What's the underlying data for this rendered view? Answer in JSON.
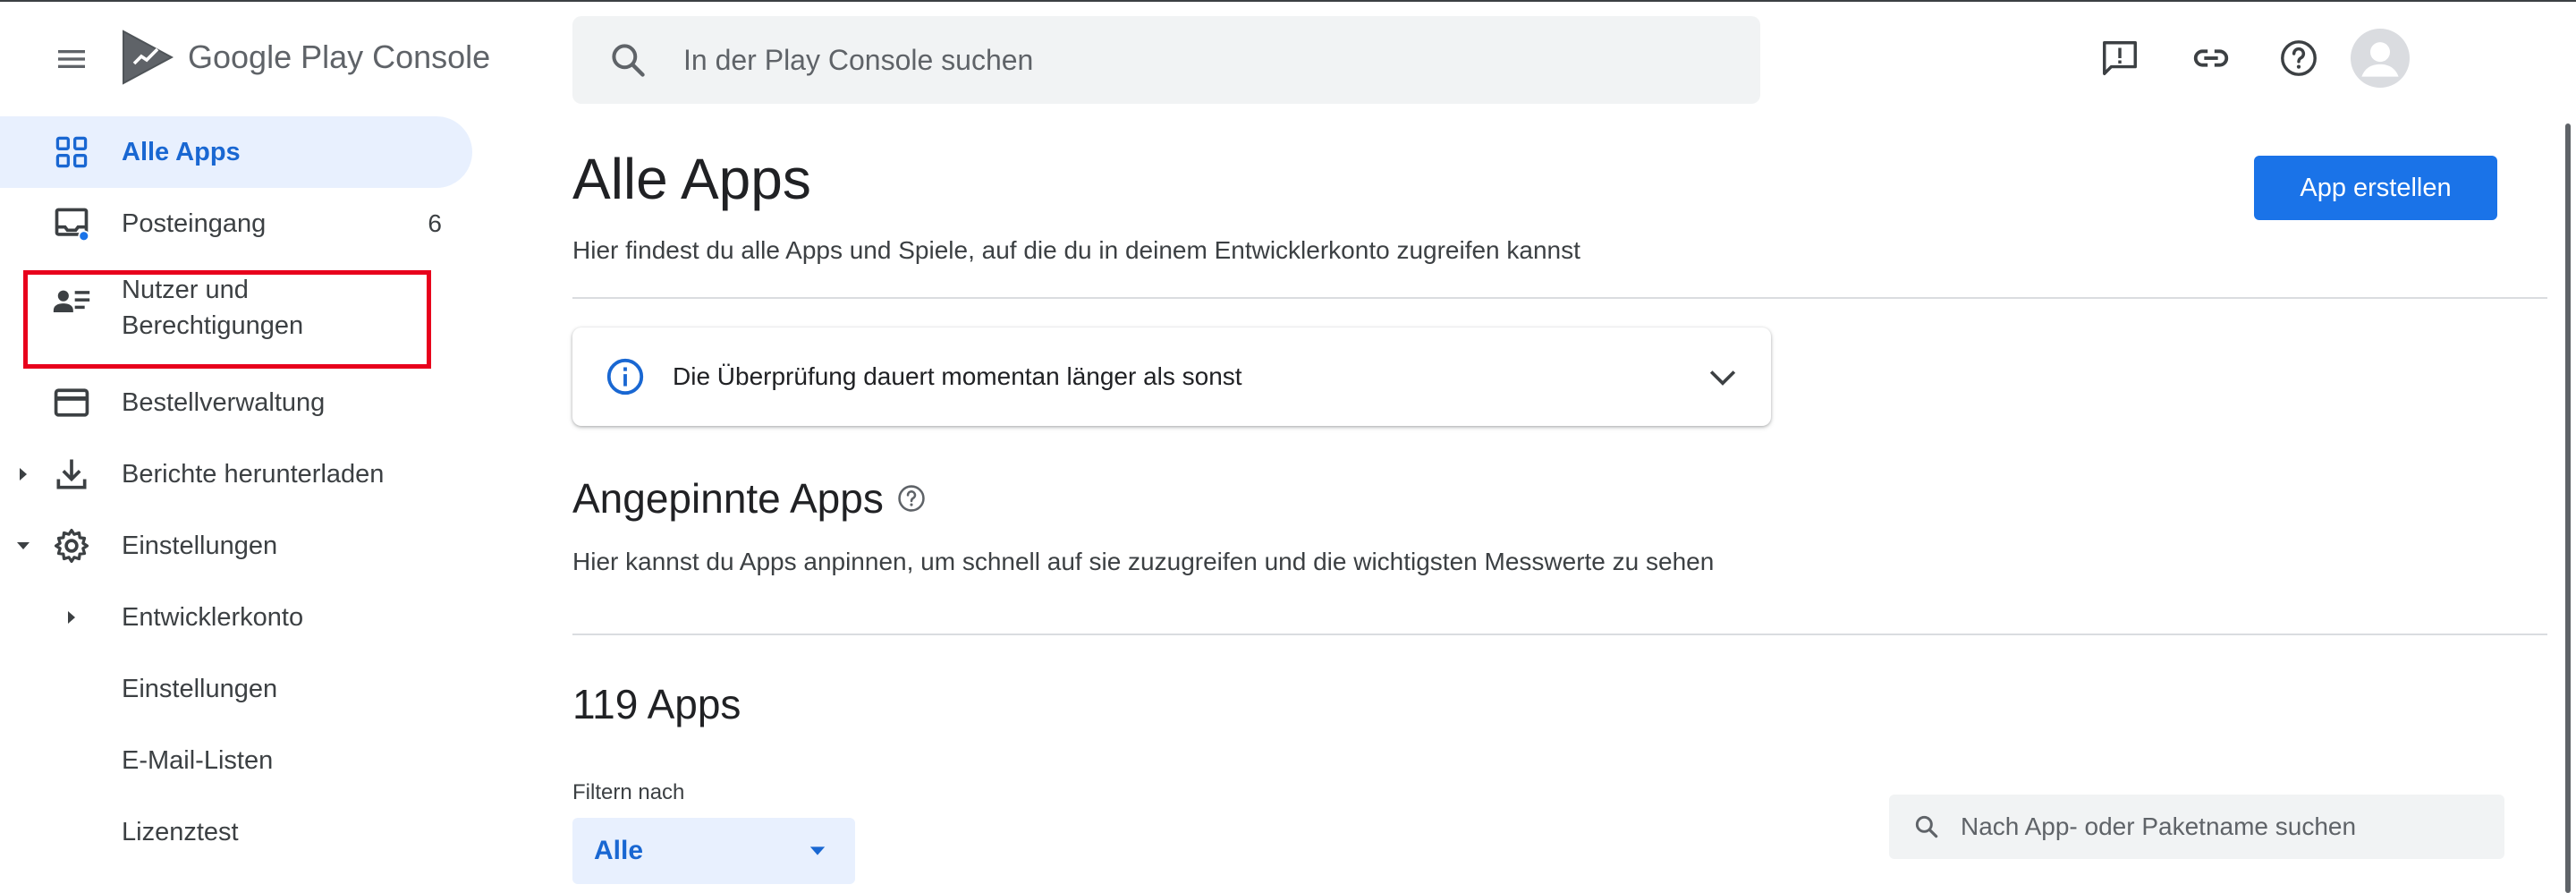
{
  "header": {
    "product_name": "Google Play Console",
    "search_placeholder": "In der Play Console suchen"
  },
  "sidebar": {
    "items": [
      {
        "label": "Alle Apps",
        "icon": "apps-grid-icon",
        "active": true
      },
      {
        "label": "Posteingang",
        "icon": "inbox-icon",
        "badge": "6"
      },
      {
        "label": "Nutzer und Berechtigungen",
        "line1": "Nutzer und",
        "line2": "Berechtigungen",
        "icon": "users-permissions-icon"
      },
      {
        "label": "Bestellverwaltung",
        "icon": "credit-card-icon"
      },
      {
        "label": "Berichte herunterladen",
        "icon": "download-icon",
        "expandable": true
      },
      {
        "label": "Einstellungen",
        "icon": "gear-icon",
        "expanded": true
      },
      {
        "label": "Entwicklerkonto",
        "expandable": true
      },
      {
        "label": "Einstellungen"
      },
      {
        "label": "E-Mail-Listen"
      },
      {
        "label": "Lizenztest"
      }
    ]
  },
  "main": {
    "title": "Alle Apps",
    "subtitle": "Hier findest du alle Apps und Spiele, auf die du in deinem Entwicklerkonto zugreifen kannst",
    "create_button": "App erstellen",
    "notice": "Die Überprüfung dauert momentan länger als sonst",
    "pinned_title": "Angepinnte Apps",
    "pinned_subtitle": "Hier kannst du Apps anpinnen, um schnell auf sie zuzugreifen und die wichtigsten Messwerte zu sehen",
    "apps_count_title": "119 Apps",
    "filter_label": "Filtern nach",
    "filter_value": "Alle",
    "app_search_placeholder": "Nach App- oder Paketname suchen"
  },
  "colors": {
    "accent": "#1a73e8",
    "active_bg": "#e8f0fe",
    "highlight": "#e8001c"
  }
}
